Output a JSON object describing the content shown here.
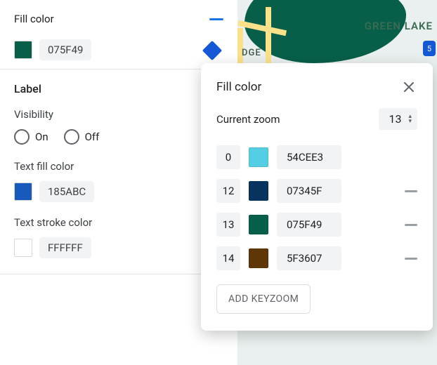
{
  "panel": {
    "fill": {
      "title": "Fill color",
      "swatch_color": "#075F49",
      "hex": "075F49"
    },
    "label_section": {
      "heading": "Label",
      "visibility_label": "Visibility",
      "on": "On",
      "off": "Off",
      "text_fill_label": "Text fill color",
      "text_fill_swatch": "#185ABC",
      "text_fill_hex": "185ABC",
      "text_stroke_label": "Text stroke color",
      "text_stroke_swatch": "#FFFFFF",
      "text_stroke_hex": "FFFFFF"
    }
  },
  "popover": {
    "title": "Fill color",
    "zoom_label": "Current zoom",
    "zoom_value": "13",
    "stops": [
      {
        "key": "0",
        "color": "#54CEE3",
        "hex": "54CEE3",
        "removable": false
      },
      {
        "key": "12",
        "color": "#07345F",
        "hex": "07345F",
        "removable": true
      },
      {
        "key": "13",
        "color": "#075F49",
        "hex": "075F49",
        "removable": true
      },
      {
        "key": "14",
        "color": "#5F3607",
        "hex": "5F3607",
        "removable": true
      }
    ],
    "add_button": "ADD KEYZOOM"
  },
  "map": {
    "label1": "GREEN LAKE",
    "label2": "DGE",
    "shield": "5"
  }
}
